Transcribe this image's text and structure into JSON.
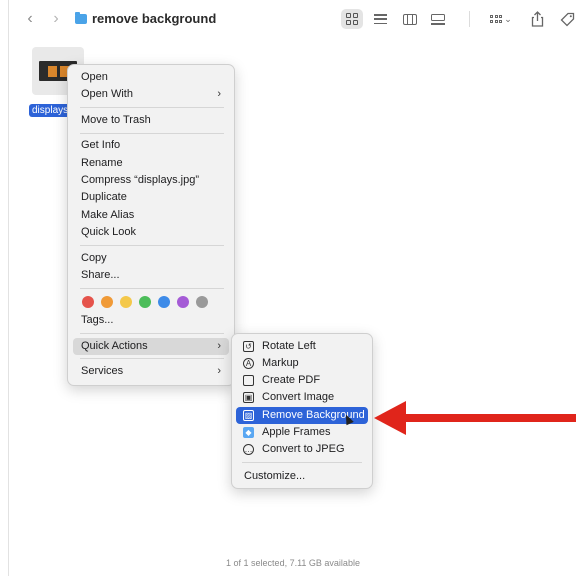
{
  "window": {
    "title": "remove background",
    "status_text": "1 of 1 selected, 7.11 GB available"
  },
  "toolbar": {
    "back_icon": "chevron-left-icon",
    "forward_icon": "chevron-right-icon",
    "view_icons": [
      "grid-view-icon",
      "list-view-icon",
      "column-view-icon",
      "gallery-view-icon"
    ],
    "group_icon": "group-by-icon",
    "share_icon": "share-icon",
    "tag_icon": "tag-icon"
  },
  "file": {
    "name": "displays.jpg",
    "label_visible": "displays."
  },
  "context_menu": {
    "items": [
      {
        "label": "Open"
      },
      {
        "label": "Open With",
        "submenu": true
      },
      {
        "label": "Move to Trash"
      },
      {
        "label": "Get Info"
      },
      {
        "label": "Rename"
      },
      {
        "label": "Compress “displays.jpg”"
      },
      {
        "label": "Duplicate"
      },
      {
        "label": "Make Alias"
      },
      {
        "label": "Quick Look"
      },
      {
        "label": "Copy"
      },
      {
        "label": "Share..."
      },
      {
        "label": "Tags..."
      },
      {
        "label": "Quick Actions",
        "submenu": true,
        "highlighted": true
      },
      {
        "label": "Services",
        "submenu": true
      }
    ],
    "tag_colors": [
      "#e5534b",
      "#f09a37",
      "#f4c84a",
      "#4cbd5a",
      "#3e8be8",
      "#a55bd6",
      "#9a9a9a"
    ]
  },
  "quick_actions_menu": {
    "items": [
      {
        "label": "Rotate Left",
        "icon": "rotate-left-icon"
      },
      {
        "label": "Markup",
        "icon": "markup-icon"
      },
      {
        "label": "Create PDF",
        "icon": "document-icon"
      },
      {
        "label": "Convert Image",
        "icon": "convert-image-icon"
      },
      {
        "label": "Remove Background",
        "icon": "remove-background-icon",
        "selected": true
      },
      {
        "label": "Apple Frames",
        "icon": "shortcut-icon"
      },
      {
        "label": "Convert to JPEG",
        "icon": "convert-icon"
      },
      {
        "label": "Customize..."
      }
    ]
  },
  "colors": {
    "selection_blue": "#2d63d8",
    "annotation_arrow": "#e0251b"
  }
}
